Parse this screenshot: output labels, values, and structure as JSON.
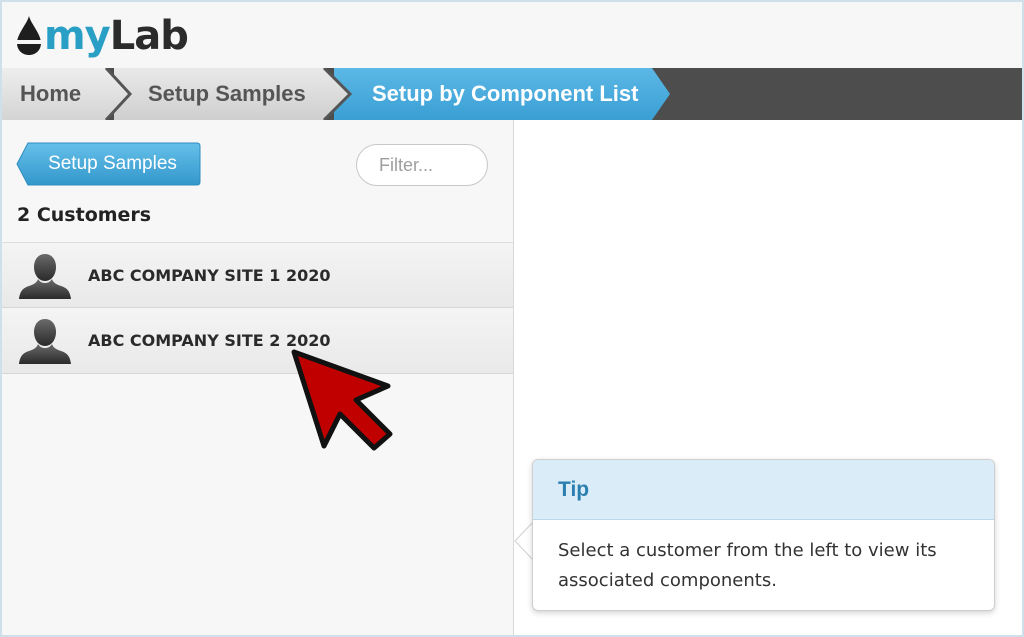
{
  "app": {
    "logo_my": "my",
    "logo_lab": "Lab"
  },
  "breadcrumb": {
    "items": [
      {
        "label": "Home"
      },
      {
        "label": "Setup Samples"
      },
      {
        "label": "Setup by Component List"
      }
    ]
  },
  "sidebar": {
    "back_button_label": "Setup Samples",
    "filter_placeholder": "Filter...",
    "count_label": "2 Customers",
    "customers": [
      {
        "name": "ABC COMPANY SITE 1 2020",
        "icon": "person-icon"
      },
      {
        "name": "ABC COMPANY SITE 2 2020",
        "icon": "person-icon"
      }
    ]
  },
  "tip": {
    "title": "Tip",
    "line1": "Select a customer from the left to view its",
    "line2": "associated components."
  },
  "colors": {
    "accent": "#3aa3d6",
    "breadcrumb_bg": "#4d4d4d",
    "tip_header_bg": "#d9ecf7",
    "pointer": "#c00000"
  }
}
